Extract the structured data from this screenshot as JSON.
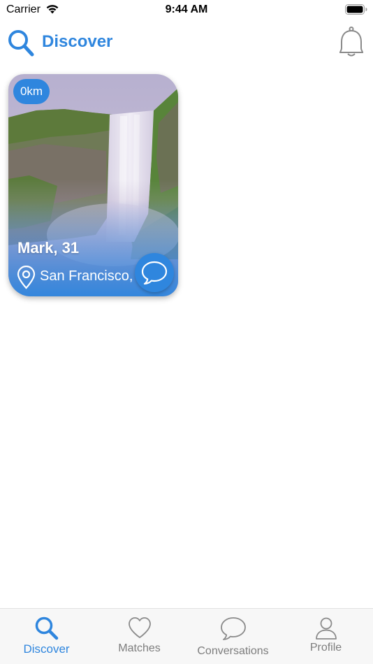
{
  "status_bar": {
    "carrier": "Carrier",
    "time": "9:44 AM"
  },
  "header": {
    "title": "Discover"
  },
  "card": {
    "distance": "0km",
    "name": "Mark, 31",
    "location": "San Francisco,"
  },
  "tabs": [
    {
      "label": "Discover",
      "icon": "search-icon",
      "active": true
    },
    {
      "label": "Matches",
      "icon": "heart-icon",
      "active": false
    },
    {
      "label": "Conversations",
      "icon": "chat-bubble-icon",
      "active": false
    },
    {
      "label": "Profile",
      "icon": "person-icon",
      "active": false
    }
  ],
  "colors": {
    "accent": "#2f86de",
    "inactive": "#7d7d7d",
    "tabbar_bg": "#f7f7f7"
  }
}
